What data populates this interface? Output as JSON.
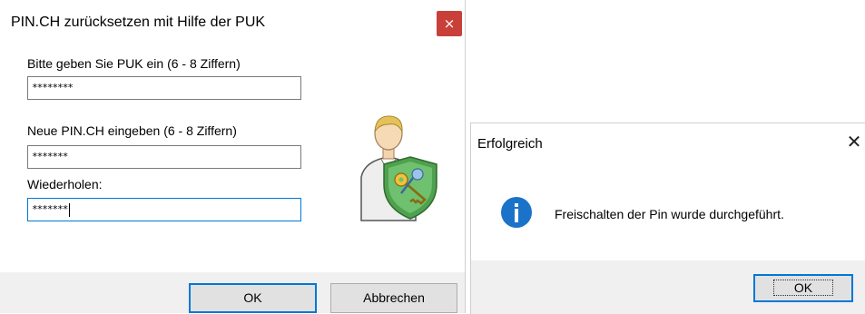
{
  "puk_dialog": {
    "title": "PIN.CH zurücksetzen mit Hilfe der PUK",
    "close_glyph": "×",
    "puk_label": "Bitte geben Sie PUK ein (6 - 8 Ziffern)",
    "puk_value": "********",
    "new_pin_label": "Neue PIN.CH eingeben (6 - 8 Ziffern)",
    "new_pin_value": "*******",
    "repeat_label": "Wiederholen:",
    "repeat_value": "*******",
    "ok_label": "OK",
    "cancel_label": "Abbrechen",
    "icon": "user-key-shield-icon",
    "close_color": "#c9403a",
    "focus_color": "#0078d7"
  },
  "success_dialog": {
    "title": "Erfolgreich",
    "close_glyph": "✕",
    "message": "Freischalten der Pin wurde durchgeführt.",
    "ok_label": "OK",
    "icon": "info-icon",
    "info_color": "#1a73c9"
  }
}
